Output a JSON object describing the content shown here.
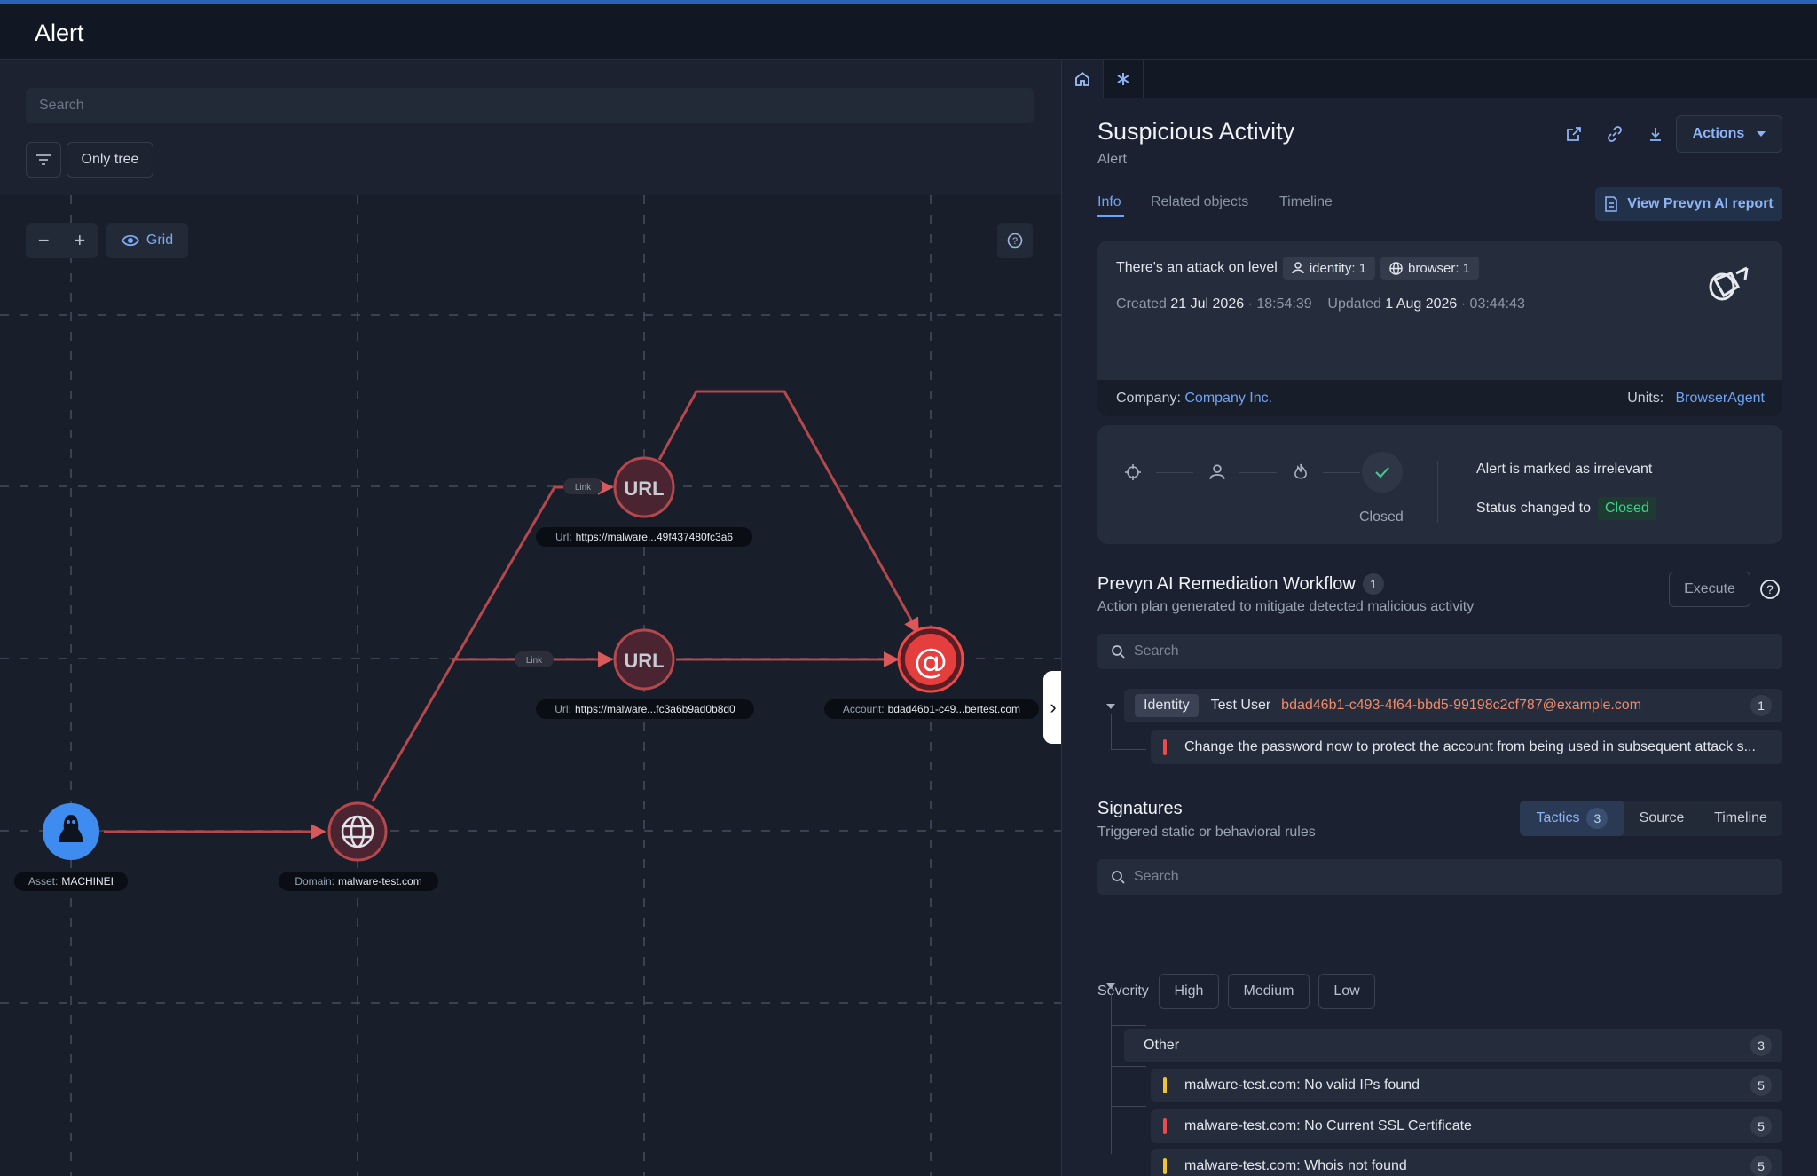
{
  "header": {
    "title": "Alert"
  },
  "graph_panel": {
    "search_placeholder": "Search",
    "only_tree_label": "Only tree",
    "zoom_out": "−",
    "zoom_in": "+",
    "grid_label": "Grid",
    "nodes": {
      "asset": {
        "key": "Asset:",
        "value": "MACHINEI",
        "icon": "tux-icon"
      },
      "domain": {
        "key": "Domain:",
        "value": "malware-test.com",
        "icon": "globe-icon"
      },
      "url1": {
        "text": "URL",
        "key": "Url:",
        "value": "https://malware...49f437480fc3a6"
      },
      "url2": {
        "text": "URL",
        "key": "Url:",
        "value": "https://malware...fc3a6b9ad0b8d0"
      },
      "account": {
        "text": "@",
        "key": "Account:",
        "value": "bdad46b1-c49...bertest.com"
      }
    },
    "edge_labels": {
      "link1": "Link",
      "link2": "Link"
    }
  },
  "detail": {
    "title": "Suspicious Activity",
    "subtitle": "Alert",
    "actions_label": "Actions",
    "tabs": [
      {
        "label": "Info",
        "active": true
      },
      {
        "label": "Related objects",
        "active": false
      },
      {
        "label": "Timeline",
        "active": false
      }
    ],
    "ai_report_label": "View Prevyn AI report",
    "attack": {
      "prefix": "There's an attack on level",
      "identity_chip": "identity: 1",
      "browser_chip": "browser: 1"
    },
    "dates": {
      "created_label": "Created",
      "created_date": "21 Jul 2026",
      "created_time": "· 18:54:39",
      "updated_label": "Updated",
      "updated_date": "1 Aug 2026",
      "updated_time": "· 03:44:43"
    },
    "company_label": "Company:",
    "company_value": "Company Inc.",
    "units_label": "Units:",
    "units_value": "BrowserAgent",
    "status": {
      "step_label": "Closed",
      "message1": "Alert is marked as irrelevant",
      "message2_prefix": "Status changed to",
      "message2_value": "Closed",
      "accent": "#3ed18b"
    },
    "remediation": {
      "title": "Prevyn AI Remediation Workflow",
      "count": "1",
      "subtitle": "Action plan generated to mitigate detected malicious activity",
      "execute_label": "Execute",
      "search_placeholder": "Search",
      "identity_chip": "Identity",
      "user_name": "Test User",
      "user_email": "bdad46b1-c493-4f64-bbd5-99198c2cf787@example.com",
      "user_count": "1",
      "action_text": "Change the password now to protect the account from being used in subsequent attack s..."
    },
    "signatures": {
      "title": "Signatures",
      "subtitle": "Triggered static or behavioral rules",
      "segments": {
        "tactics": "Tactics",
        "tactics_count": "3",
        "source": "Source",
        "timeline": "Timeline"
      },
      "search_placeholder": "Search",
      "severity_label": "Severity",
      "severity_high": "High",
      "severity_medium": "Medium",
      "severity_low": "Low",
      "group_name": "Other",
      "group_count": "3",
      "items": [
        {
          "text": "malware-test.com: No valid IPs found",
          "count": "5",
          "color": "#f2c230"
        },
        {
          "text": "malware-test.com: No Current SSL Certificate",
          "count": "5",
          "color": "#ef4a4a"
        },
        {
          "text": "malware-test.com: Whois not found",
          "count": "5",
          "color": "#f2c230"
        }
      ]
    }
  }
}
